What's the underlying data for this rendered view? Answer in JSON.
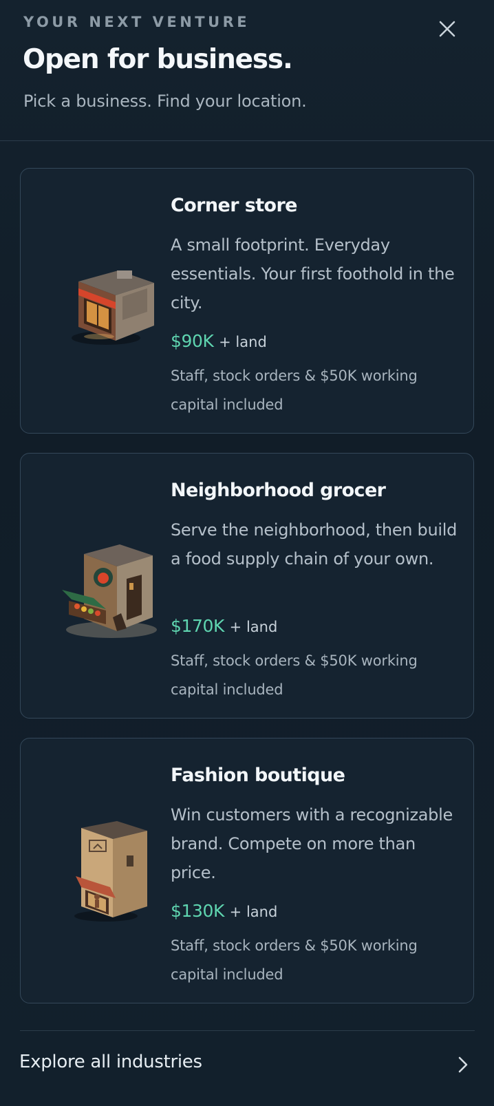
{
  "header": {
    "eyebrow": "YOUR NEXT VENTURE",
    "title": "Open for business.",
    "subtitle": "Pick a business. Find your location.",
    "close_icon": "close-icon"
  },
  "businesses": [
    {
      "name": "Corner store",
      "description": "A small footprint. Everyday essentials. Your first foothold in the city.",
      "price": "$90K",
      "price_suffix": "+ land",
      "note": "Staff, stock orders & $50K working capital included",
      "icon": "corner-store-building-icon"
    },
    {
      "name": "Neighborhood grocer",
      "description": "Serve the neighborhood, then build a food supply chain of your own.",
      "price": "$170K",
      "price_suffix": "+ land",
      "note": "Staff, stock orders & $50K working capital included",
      "icon": "grocer-building-icon"
    },
    {
      "name": "Fashion boutique",
      "description": "Win customers with a recognizable brand. Compete on more than price.",
      "price": "$130K",
      "price_suffix": "+ land",
      "note": "Staff, stock orders & $50K working capital included",
      "icon": "boutique-building-icon"
    }
  ],
  "footer": {
    "explore_label": "Explore all industries",
    "chevron_icon": "chevron-right-icon"
  },
  "colors": {
    "background": "#121f2b",
    "card_border": "#34485a",
    "price_accent": "#5fd5b0"
  }
}
